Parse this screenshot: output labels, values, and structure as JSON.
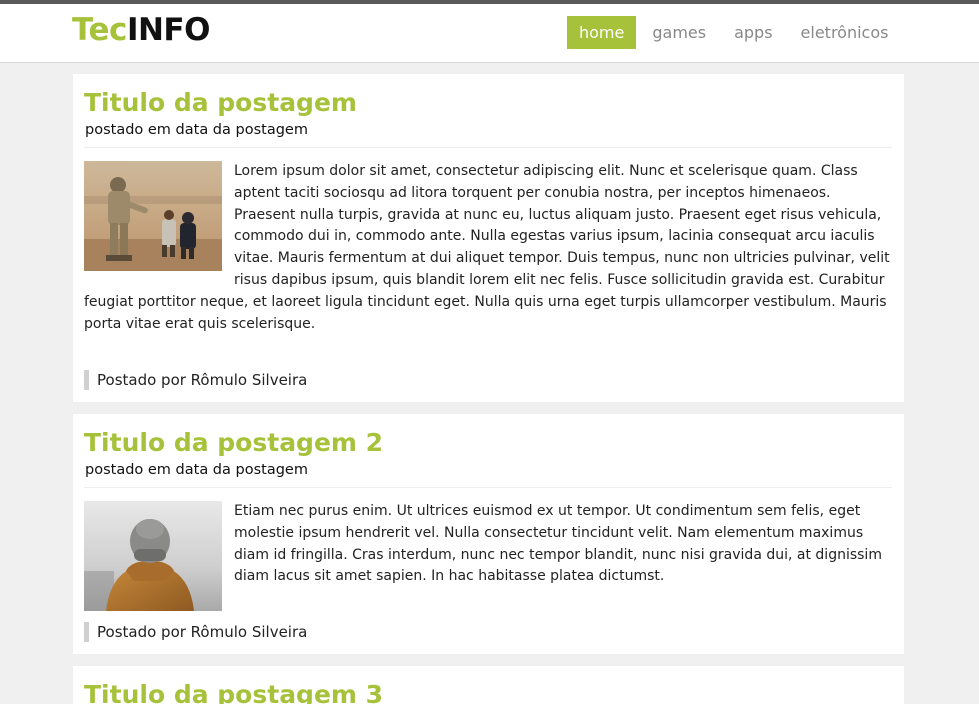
{
  "header": {
    "logo_part1": "Tec",
    "logo_part2": "INFO",
    "nav": [
      {
        "label": "home",
        "active": true
      },
      {
        "label": "games",
        "active": false
      },
      {
        "label": "apps",
        "active": false
      },
      {
        "label": "eletrônicos",
        "active": false
      }
    ]
  },
  "posts": [
    {
      "title": "Titulo da postagem",
      "date": "postado em data da postagem",
      "image": "soldier-with-children-photo",
      "body": "Lorem ipsum dolor sit amet, consectetur adipiscing elit. Nunc et scelerisque quam. Class aptent taciti sociosqu ad litora torquent per conubia nostra, per inceptos himenaeos. Praesent nulla turpis, gravida at nunc eu, luctus aliquam justo. Praesent eget risus vehicula, commodo dui in, commodo ante. Nulla egestas varius ipsum, lacinia consequat arcu iaculis vitae. Mauris fermentum at dui aliquet tempor. Duis tempus, nunc non ultricies pulvinar, velit risus dapibus ipsum, quis blandit lorem elit nec felis. Fusce sollicitudin gravida est. Curabitur feugiat porttitor neque, et laoreet ligula tincidunt eget. Nulla quis urna eget turpis ullamcorper vestibulum. Mauris porta vitae erat quis scelerisque.",
      "author": "Postado por Rômulo Silveira"
    },
    {
      "title": "Titulo da postagem 2",
      "date": "postado em data da postagem",
      "image": "person-in-beanie-photo",
      "body": "Etiam nec purus enim. Ut ultrices euismod ex ut tempor. Ut condimentum sem felis, eget molestie ipsum hendrerit vel. Nulla consectetur tincidunt velit. Nam elementum maximus diam id fringilla. Cras interdum, nunc nec tempor blandit, nunc nisi gravida dui, at dignissim diam lacus sit amet sapien. In hac habitasse platea dictumst.",
      "author": "Postado por Rômulo Silveira"
    },
    {
      "title": "Titulo da postagem 3"
    }
  ],
  "colors": {
    "accent": "#a6c23a",
    "page_bg": "#f0f0f0",
    "nav_text": "#888888"
  }
}
